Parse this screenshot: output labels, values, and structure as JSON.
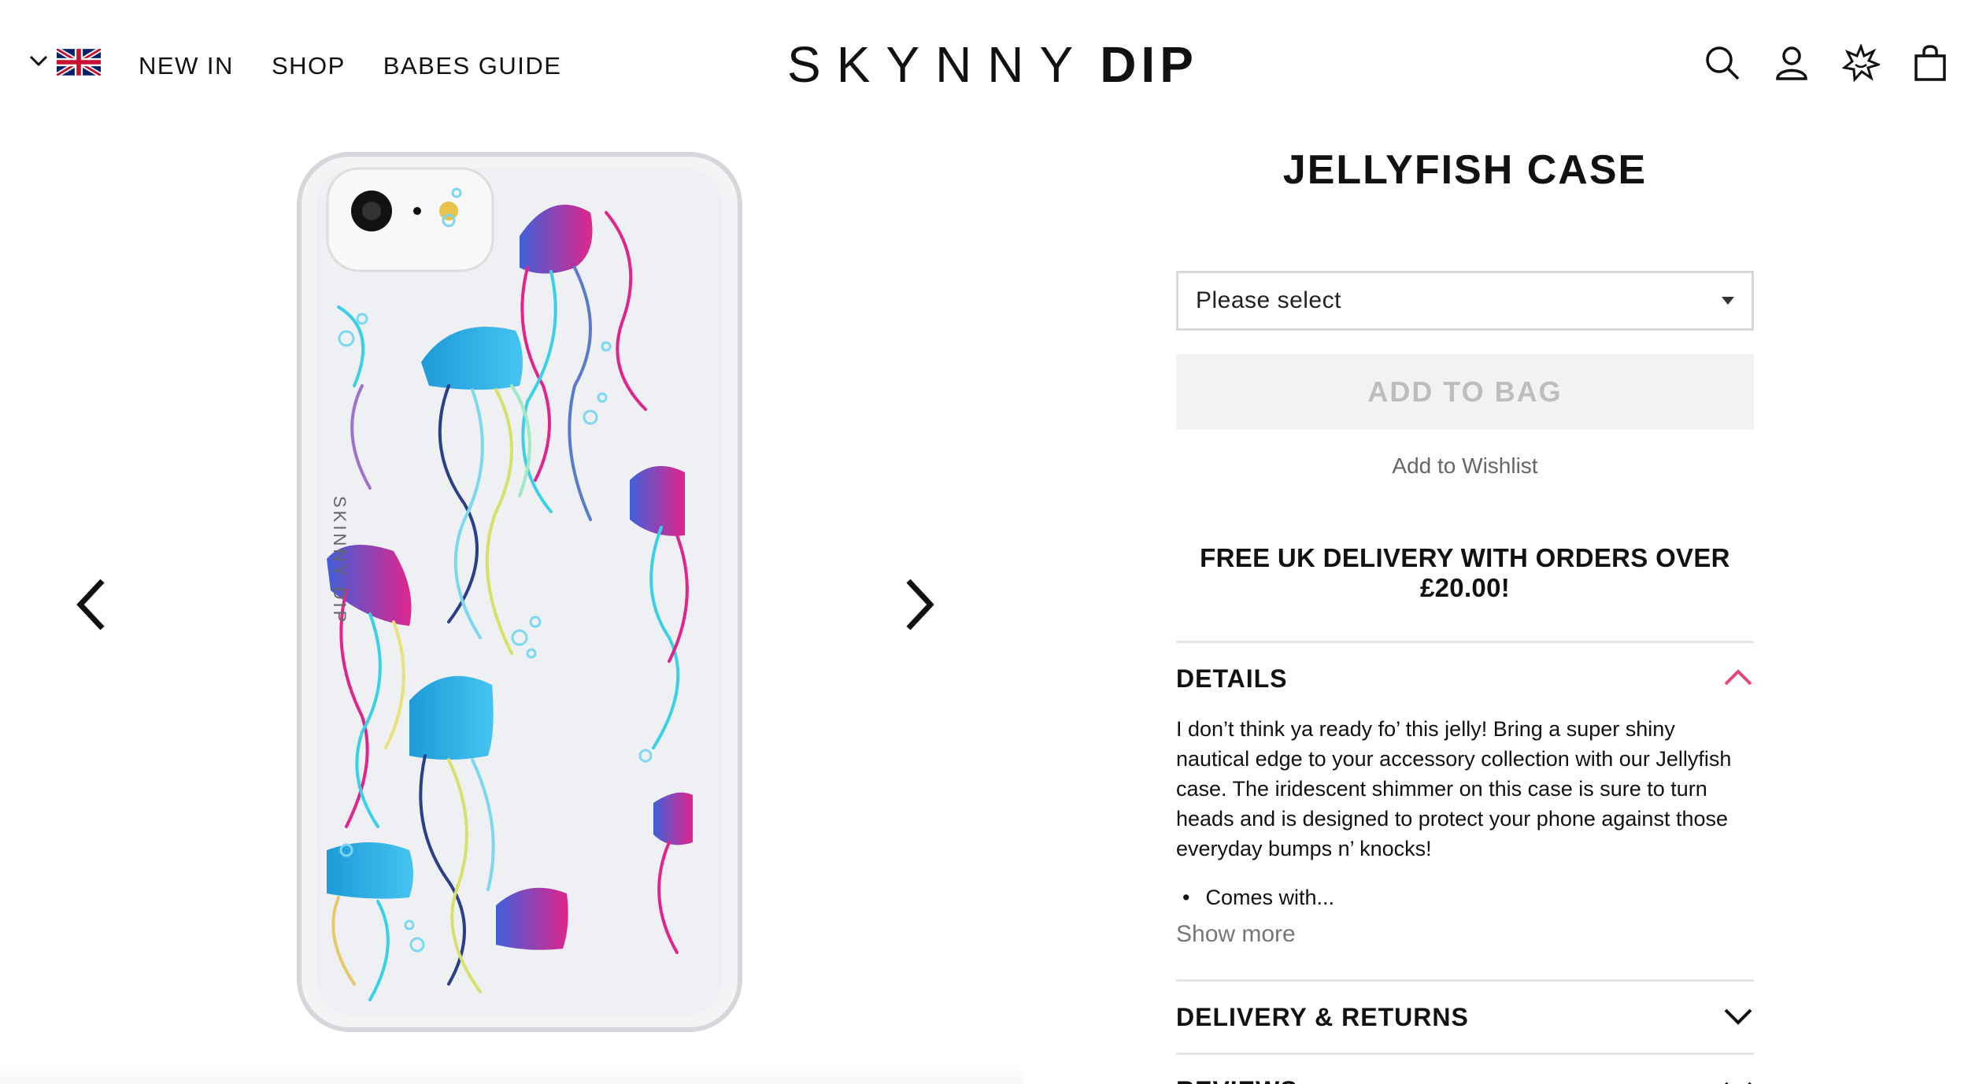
{
  "header": {
    "locale_icon": "uk-flag-icon",
    "nav": [
      "NEW IN",
      "SHOP",
      "BABES GUIDE"
    ],
    "logo": {
      "thin": "SKYNNY",
      "bold": "DIP"
    },
    "icons": [
      "search-icon",
      "account-icon",
      "babe-star-icon",
      "bag-icon"
    ]
  },
  "product": {
    "title": "JELLYFISH CASE",
    "select_placeholder": "Please select",
    "add_to_bag": "ADD TO BAG",
    "wishlist": "Add to Wishlist",
    "delivery_banner": "FREE UK DELIVERY WITH ORDERS OVER £20.00!",
    "details": {
      "heading": "DETAILS",
      "description": "I don’t think ya ready fo’ this jelly! Bring a super shiny nautical edge to your accessory collection with our Jellyfish case. The iridescent shimmer on this case is sure to turn heads and is designed to protect your phone against those everyday bumps n’ knocks!",
      "bullet": "Comes with...",
      "show_more": "Show more"
    },
    "delivery_returns": "DELIVERY & RETURNS",
    "reviews": "REVIEWS"
  },
  "gallery": {
    "prev_icon": "chevron-left-icon",
    "next_icon": "chevron-right-icon"
  },
  "colors": {
    "accent_pink": "#e8457a",
    "button_bg": "#f2f2f2",
    "button_text": "#bdbdbd"
  }
}
